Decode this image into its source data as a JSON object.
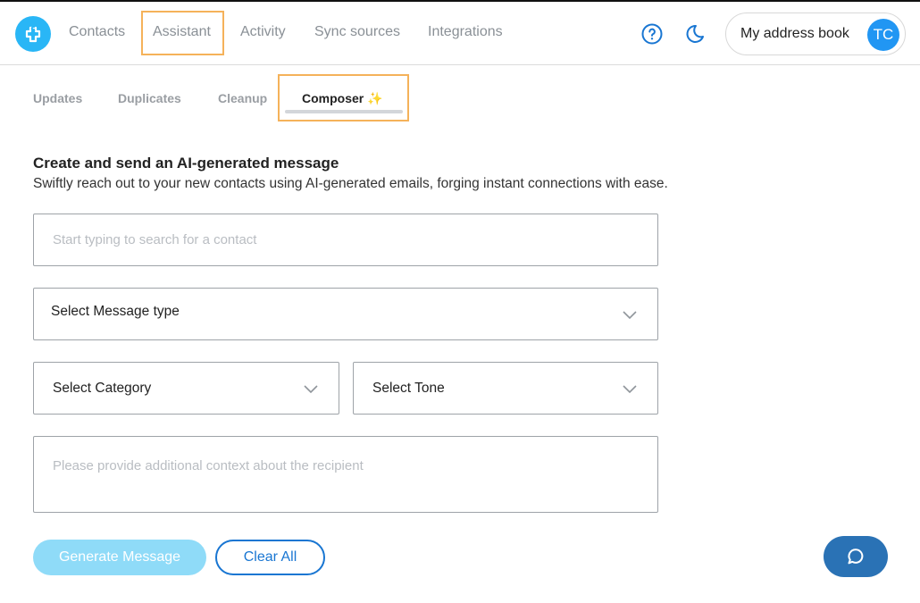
{
  "header": {
    "logo_icon": "contacts-plus-logo",
    "nav": [
      {
        "label": "Contacts",
        "active": false
      },
      {
        "label": "Assistant",
        "active": true
      },
      {
        "label": "Activity",
        "active": false
      },
      {
        "label": "Sync sources",
        "active": false
      },
      {
        "label": "Integrations",
        "active": false
      }
    ],
    "help_icon": "help-circle-icon",
    "theme_icon": "moon-icon",
    "address_book": {
      "label": "My address book",
      "avatar_initials": "TC"
    }
  },
  "subtabs": [
    {
      "label": "Updates",
      "active": false
    },
    {
      "label": "Duplicates",
      "active": false
    },
    {
      "label": "Cleanup",
      "active": false
    },
    {
      "label": "Composer",
      "active": true,
      "icon": "✨"
    }
  ],
  "composer": {
    "title": "Create and send an AI-generated message",
    "description": "Swiftly reach out to your new contacts using AI-generated emails, forging instant connections with ease.",
    "contact_search": {
      "placeholder": "Start typing to search for a contact",
      "value": ""
    },
    "message_type": {
      "label": "Select Message type"
    },
    "category": {
      "label": "Select Category"
    },
    "tone": {
      "label": "Select Tone"
    },
    "context": {
      "placeholder": "Please provide additional context about the recipient",
      "value": ""
    },
    "generate_label": "Generate Message",
    "clear_label": "Clear All"
  },
  "chat": {
    "icon": "chat-bubble-icon"
  },
  "colors": {
    "accent": "#29b6f6",
    "primary": "#1976d2",
    "highlight": "#f5b25a",
    "generate_disabled": "#8fdbf8",
    "chat": "#2a72b5"
  }
}
